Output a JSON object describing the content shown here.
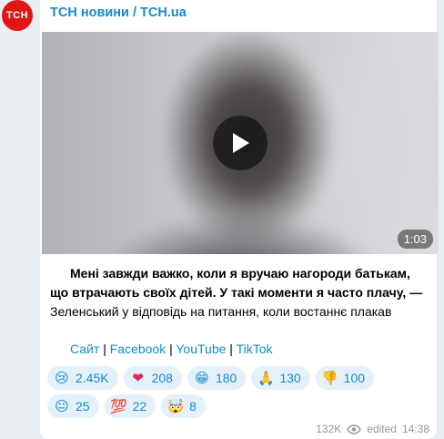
{
  "channel": {
    "avatar_text": "ТСН",
    "name": "ТСН новини / TCH.ua"
  },
  "video": {
    "duration": "1:03"
  },
  "caption": {
    "bold_text": "Мені завжди важко, коли я вручаю нагороди батькам, що втрачають своїх дітей. У такі моменти я часто плачу, —",
    "normal_text": " Зеленський у відповідь на питання, коли востаннє плакав"
  },
  "links": [
    {
      "label": "Сайт"
    },
    {
      "label": "Facebook"
    },
    {
      "label": "YouTube"
    },
    {
      "label": "TikTok"
    }
  ],
  "link_separator": "|",
  "reactions": [
    {
      "icon": "crying-face-icon",
      "glyph": "😢",
      "count": "2.45K"
    },
    {
      "icon": "red-heart-icon",
      "glyph": "❤",
      "count": "208"
    },
    {
      "icon": "grinning-face-icon",
      "glyph": "😁",
      "count": "180"
    },
    {
      "icon": "folded-hands-icon",
      "glyph": "🙏",
      "count": "130"
    },
    {
      "icon": "thumbs-down-icon",
      "glyph": "👎",
      "count": "100"
    },
    {
      "icon": "neutral-face-icon",
      "glyph": "😐",
      "count": "25"
    },
    {
      "icon": "hundred-points-icon",
      "glyph": "💯",
      "count": "22"
    },
    {
      "icon": "exploding-head-icon",
      "glyph": "🤯",
      "count": "8"
    }
  ],
  "footer": {
    "views": "132K",
    "edited_label": "edited",
    "time": "14:38"
  },
  "colors": {
    "accent": "#168acd",
    "avatar": "#e01616",
    "reaction_bg": "#e4f1fa"
  }
}
